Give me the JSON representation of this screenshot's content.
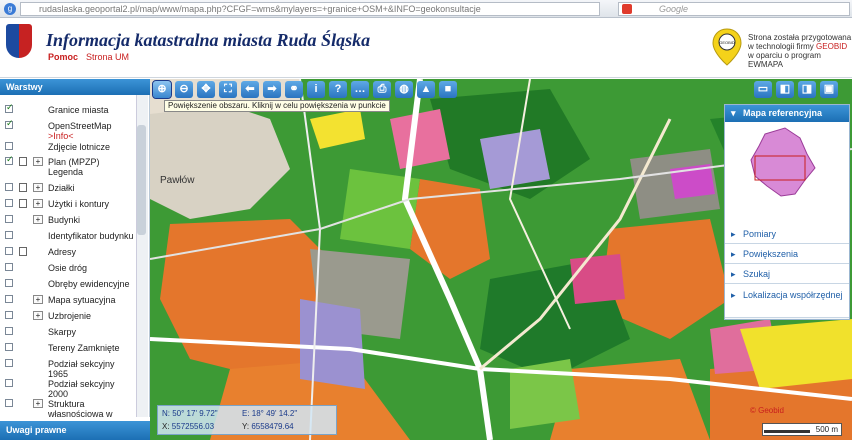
{
  "browser": {
    "url": "rudaslaska.geoportal2.pl/map/www/mapa.php?CFGF=wms&mylayers=+granice+OSM+&INFO=geokonsultacje",
    "search_placeholder": "Google"
  },
  "header": {
    "title": "Informacja katastralna miasta Ruda Śląska",
    "help": "Pomoc",
    "um_link": "Strona UM",
    "geobid_line1": "Strona została przygotowana",
    "geobid_line2_pre": "w technologii firmy ",
    "geobid_brand": "GEOBID",
    "geobid_line3": "w oparciu o program EWMAPA",
    "geobid_logo_text": "GEOBID"
  },
  "sidebar": {
    "title": "Warstwy",
    "uwagi": "Uwagi prawne",
    "layers": [
      {
        "label": "Granice miasta",
        "checked": true,
        "expand": false,
        "doc": false
      },
      {
        "label": "OpenStreetMap",
        "sub": ">Info<",
        "checked": true,
        "expand": false,
        "doc": false
      },
      {
        "label": "Zdjęcie lotnicze",
        "checked": false,
        "expand": false,
        "doc": false
      },
      {
        "label": "Plan (MPZP)  Legenda",
        "checked": true,
        "expand": true,
        "doc": true
      },
      {
        "label": "Działki",
        "checked": false,
        "expand": true,
        "doc": true
      },
      {
        "label": "Użytki i kontury",
        "checked": false,
        "expand": true,
        "doc": true
      },
      {
        "label": "Budynki",
        "checked": false,
        "expand": true,
        "doc": false
      },
      {
        "label": "Identyfikator budynku",
        "checked": false,
        "expand": false,
        "doc": false
      },
      {
        "label": "Adresy",
        "checked": false,
        "expand": false,
        "doc": true
      },
      {
        "label": "Osie dróg",
        "checked": false,
        "expand": false,
        "doc": false
      },
      {
        "label": "Obręby ewidencyjne",
        "checked": false,
        "expand": false,
        "doc": false
      },
      {
        "label": "Mapa sytuacyjna",
        "checked": false,
        "expand": true,
        "doc": false
      },
      {
        "label": "Uzbrojenie",
        "checked": false,
        "expand": true,
        "doc": false
      },
      {
        "label": "Skarpy",
        "checked": false,
        "expand": false,
        "doc": false
      },
      {
        "label": "Tereny Zamknięte",
        "checked": false,
        "expand": false,
        "doc": false
      },
      {
        "label": "Podział sekcyjny 1965",
        "checked": false,
        "expand": false,
        "doc": false
      },
      {
        "label": "Podział sekcyjny 2000",
        "checked": false,
        "expand": false,
        "doc": false
      },
      {
        "label": "Struktura własnościowa w",
        "checked": false,
        "expand": true,
        "doc": false
      }
    ]
  },
  "toolbar": {
    "tooltip": "Powiększenie obszaru. Kliknij w celu powiększenia w punkcie",
    "tools": [
      {
        "name": "zoom-in-icon",
        "glyph": "⊕"
      },
      {
        "name": "zoom-out-icon",
        "glyph": "⊖"
      },
      {
        "name": "pan-icon",
        "glyph": "✥"
      },
      {
        "name": "zoom-extent-icon",
        "glyph": "⛶"
      },
      {
        "name": "back-icon",
        "glyph": "⬅"
      },
      {
        "name": "forward-icon",
        "glyph": "➡"
      },
      {
        "name": "link-icon",
        "glyph": "⚭"
      },
      {
        "name": "info-icon",
        "glyph": "i"
      },
      {
        "name": "query-icon",
        "glyph": "?"
      },
      {
        "name": "measure-icon",
        "glyph": "…"
      },
      {
        "name": "print-icon",
        "glyph": "⎙"
      },
      {
        "name": "globe-icon",
        "glyph": "◍"
      },
      {
        "name": "warning-icon",
        "glyph": "▲"
      },
      {
        "name": "camera-icon",
        "glyph": "■"
      }
    ]
  },
  "map": {
    "place_label": "Pawłów",
    "scale": "500 m",
    "watermark": "© Geobid"
  },
  "right_panel": {
    "reference_map": "Mapa referencyjna",
    "items": [
      "Pomiary",
      "Powiększenia",
      "Szukaj",
      "Lokalizacja współrzędnej"
    ]
  },
  "coords": {
    "n": "N: 50° 17' 9.72\"",
    "e": "E: 18° 49' 14.2\"",
    "x_label": "X:",
    "x": "5572556.03",
    "y_label": "Y:",
    "y": "6558479.64"
  },
  "colors": {
    "accent": "#1c6fb4",
    "brand_red": "#c81e1e",
    "title_blue": "#152b6a"
  }
}
